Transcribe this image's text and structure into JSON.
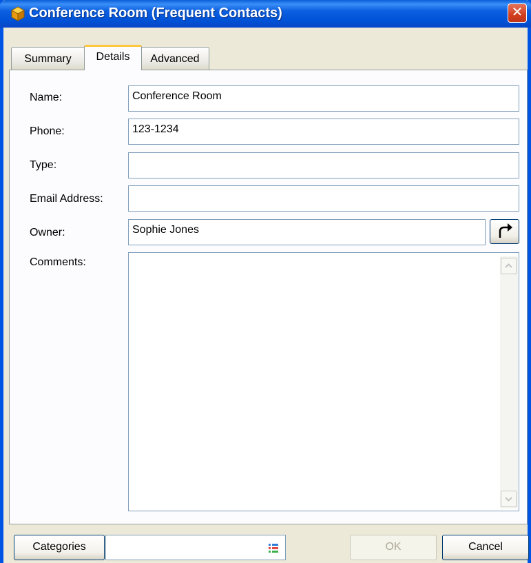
{
  "window": {
    "title": "Conference Room (Frequent Contacts)",
    "close_symbol": "✕",
    "title_icon": "cube-icon"
  },
  "tabs": [
    {
      "label": "Summary",
      "active": false
    },
    {
      "label": "Details",
      "active": true
    },
    {
      "label": "Advanced",
      "active": false
    }
  ],
  "form": {
    "name": {
      "label": "Name:",
      "value": "Conference Room"
    },
    "phone": {
      "label": "Phone:",
      "value": "123-1234"
    },
    "type": {
      "label": "Type:",
      "value": ""
    },
    "email": {
      "label": "Email Address:",
      "value": ""
    },
    "owner": {
      "label": "Owner:",
      "value": "Sophie Jones",
      "button_icon": "redirect-arrow-icon"
    },
    "comments": {
      "label": "Comments:",
      "value": ""
    }
  },
  "footer": {
    "categories_label": "Categories",
    "categories_value": "",
    "categories_icon": "list-icon",
    "ok_label": "OK",
    "ok_enabled": false,
    "cancel_label": "Cancel"
  },
  "colors": {
    "title_bar": "#0054e3",
    "active_tab_accent": "#ffc83c",
    "close_button": "#d23e1e",
    "dialog_bg": "#ece9d8"
  }
}
